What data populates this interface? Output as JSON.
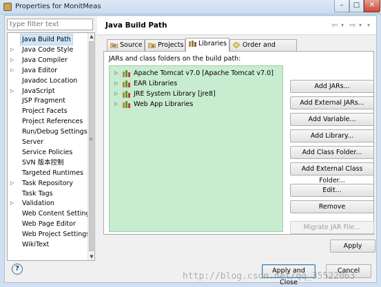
{
  "window": {
    "title": "Properties for MonitMeas",
    "min_label": "–",
    "max_label": "□",
    "close_label": "✕"
  },
  "nav": {
    "filter_placeholder": "type filter text",
    "items": [
      {
        "label": "Java Build Path",
        "expandable": false,
        "selected": true
      },
      {
        "label": "Java Code Style",
        "expandable": true
      },
      {
        "label": "Java Compiler",
        "expandable": true
      },
      {
        "label": "Java Editor",
        "expandable": true
      },
      {
        "label": "Javadoc Location",
        "expandable": false
      },
      {
        "label": "JavaScript",
        "expandable": true
      },
      {
        "label": "JSP Fragment",
        "expandable": false
      },
      {
        "label": "Project Facets",
        "expandable": false
      },
      {
        "label": "Project References",
        "expandable": false
      },
      {
        "label": "Run/Debug Settings",
        "expandable": false
      },
      {
        "label": "Server",
        "expandable": false
      },
      {
        "label": "Service Policies",
        "expandable": false
      },
      {
        "label": "SVN 版本控制",
        "expandable": false
      },
      {
        "label": "Targeted Runtimes",
        "expandable": false
      },
      {
        "label": "Task Repository",
        "expandable": true
      },
      {
        "label": "Task Tags",
        "expandable": false
      },
      {
        "label": "Validation",
        "expandable": true
      },
      {
        "label": "Web Content Settings",
        "expandable": false
      },
      {
        "label": "Web Page Editor",
        "expandable": false
      },
      {
        "label": "Web Project Settings",
        "expandable": false
      },
      {
        "label": "WikiText",
        "expandable": false
      }
    ]
  },
  "header": {
    "title": "Java Build Path",
    "back_icon": "⇦",
    "back_menu_icon": "▾",
    "forward_icon": "⇨",
    "forward_menu_icon": "▾",
    "view_menu_icon": "▾"
  },
  "tabs": [
    {
      "label": "Source",
      "active": false
    },
    {
      "label": "Projects",
      "active": false
    },
    {
      "label": "Libraries",
      "active": true
    },
    {
      "label": "Order and Export",
      "active": false
    }
  ],
  "libraries": {
    "label": "JARs and class folders on the build path:",
    "items": [
      "Apache Tomcat v7.0 [Apache Tomcat v7.0]",
      "EAR Libraries",
      "JRE System Library [jre8]",
      "Web App Libraries"
    ]
  },
  "buttons": {
    "add_jars": "Add JARs...",
    "add_external_jars": "Add External JARs...",
    "add_variable": "Add Variable...",
    "add_library": "Add Library...",
    "add_class_folder": "Add Class Folder...",
    "add_external_class_folder": "Add External Class Folder...",
    "edit": "Edit...",
    "remove": "Remove",
    "migrate_jar": "Migrate JAR File...",
    "apply": "Apply",
    "apply_and_close": "Apply and Close",
    "cancel": "Cancel"
  },
  "help_label": "?",
  "watermark": "http://blog.csdn.net/qq_35522063",
  "colors": {
    "library_list_bg": "#c8eccf",
    "selection_bg": "#cce6fb",
    "window_frame": "#cfe0f2"
  }
}
